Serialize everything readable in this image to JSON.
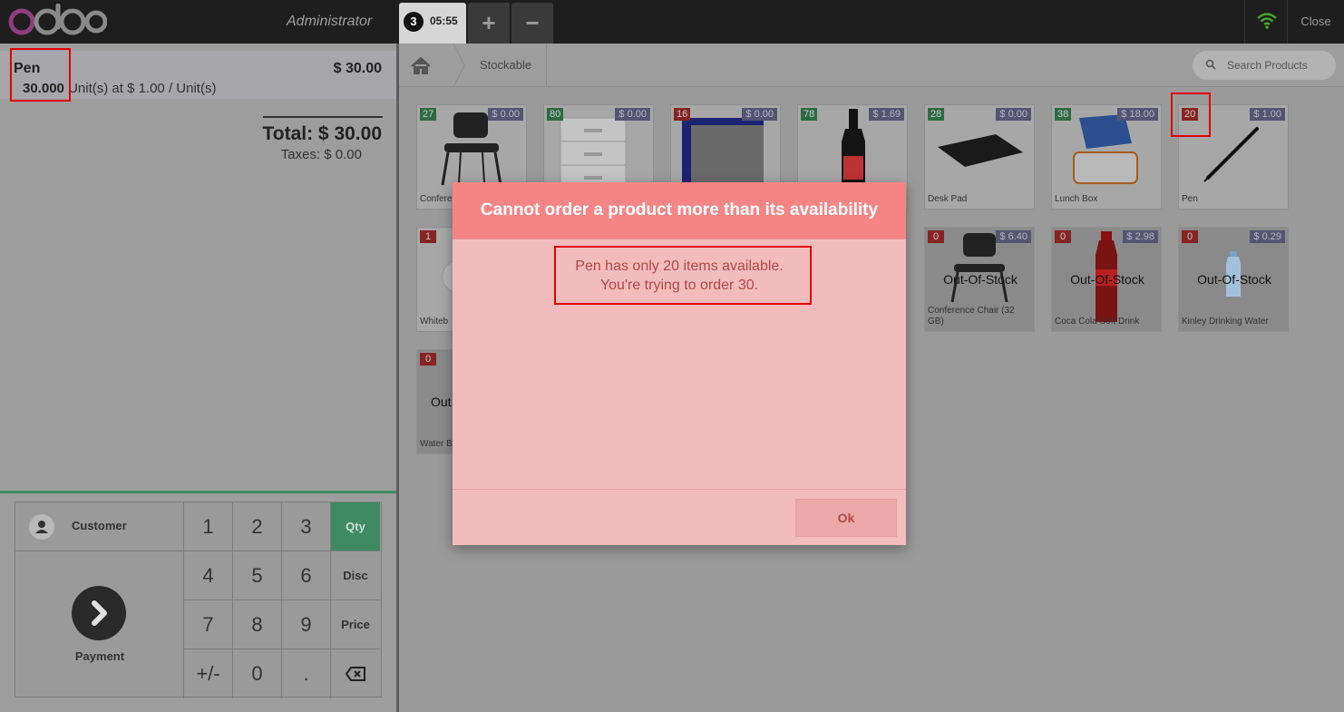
{
  "header": {
    "user": "Administrator",
    "order_number": "3",
    "order_time": "05:55",
    "add_order_label": "+",
    "remove_order_label": "−",
    "close_label": "Close"
  },
  "order": {
    "line": {
      "product": "Pen",
      "price": "$ 30.00",
      "quantity": "30.000",
      "unit_text": "Unit(s) at $ 1.00 / Unit(s)"
    },
    "total": "Total: $ 30.00",
    "taxes": "Taxes: $ 0.00"
  },
  "numpad": {
    "customer_label": "Customer",
    "payment_label": "Payment",
    "keys": [
      "1",
      "2",
      "3",
      "4",
      "5",
      "6",
      "7",
      "8",
      "9",
      "+/-",
      "0",
      "."
    ],
    "modes": [
      "Qty",
      "Disc",
      "Price"
    ],
    "active_mode": "Qty"
  },
  "breadcrumb": {
    "category": "Stockable"
  },
  "search": {
    "placeholder": "Search Products"
  },
  "products": [
    {
      "stock": "27",
      "price": "$ 0.00",
      "name": "Conference Chair (32 GB)",
      "name_shown": "Confere GB)",
      "out_of_stock": false
    },
    {
      "stock": "80",
      "price": "$ 0.00",
      "name": "",
      "out_of_stock": false
    },
    {
      "stock": "16",
      "price": "$ 0.00",
      "name": "",
      "out_of_stock": false
    },
    {
      "stock": "78",
      "price": "$ 1.69",
      "name": "",
      "out_of_stock": false
    },
    {
      "stock": "28",
      "price": "$ 0.00",
      "name": "Desk Pad",
      "out_of_stock": false
    },
    {
      "stock": "38",
      "price": "$ 18.00",
      "name": "Lunch Box",
      "out_of_stock": false
    },
    {
      "stock": "20",
      "price": "$ 1.00",
      "name": "Pen",
      "out_of_stock": false
    },
    {
      "stock": "1",
      "price": "",
      "name": "Whiteb",
      "out_of_stock": false
    },
    {
      "stock": "0",
      "price": "$ 6.40",
      "name": "Conference Chair (32 GB)",
      "out_of_stock": true
    },
    {
      "stock": "0",
      "price": "$ 2.98",
      "name": "Coca Cola Soft Drink",
      "out_of_stock": true
    },
    {
      "stock": "0",
      "price": "$ 0.29",
      "name": "Kinley Drinking Water",
      "out_of_stock": true
    },
    {
      "stock": "0",
      "price": "",
      "name": "Water B",
      "out_of_stock": true
    }
  ],
  "oos_label": "Out-Of-Stock",
  "oos_label_partial": "Out",
  "modal": {
    "title": "Cannot order a product more than its availability",
    "message_line1": "Pen has only 20 items available.",
    "message_line2": "You're trying to order 30.",
    "ok_label": "Ok"
  },
  "colors": {
    "accent_green": "#3f8a63",
    "stock_green": "#2e6b45",
    "stock_red": "#862424",
    "modal_header": "#f58585",
    "modal_body": "#f3bcbc",
    "highlight_red": "#e10000"
  }
}
